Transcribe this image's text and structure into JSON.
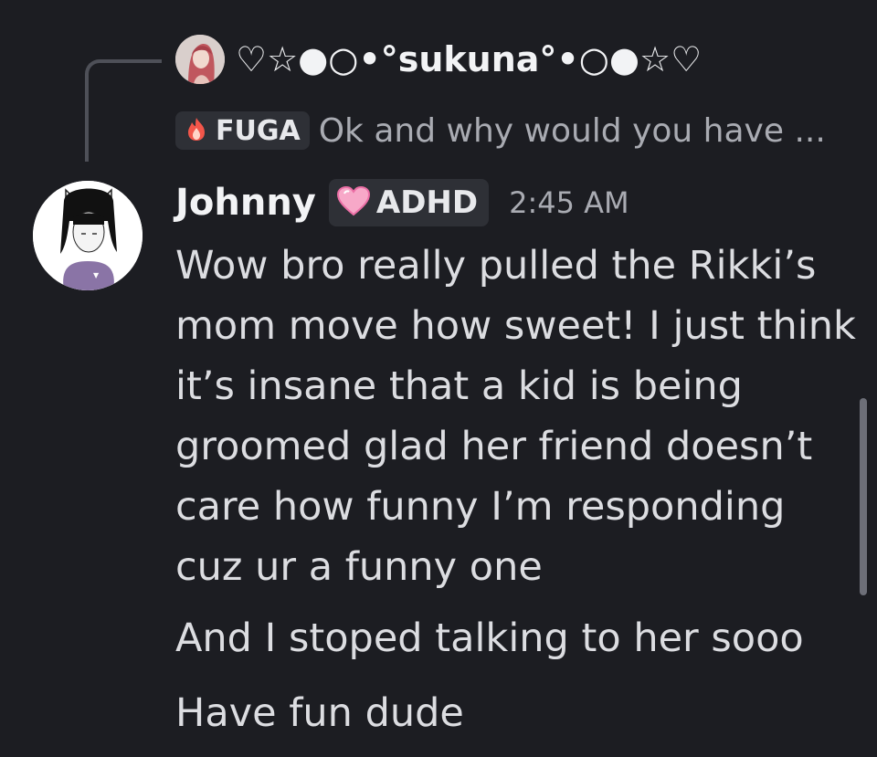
{
  "reply": {
    "author_name": "♡☆●○•°sukuna°•○●☆♡",
    "tag": {
      "icon": "fire-icon",
      "label": "FUGA"
    },
    "snippet": "Ok and why would you have ..."
  },
  "message": {
    "author": "Johnny",
    "role_badge": {
      "icon": "pink-heart-icon",
      "label": "ADHD"
    },
    "timestamp": "2:45 AM",
    "lines": [
      "Wow bro really pulled the Rikki’s mom move how sweet! I just think it’s insane that a kid is being groomed glad her friend doesn’t care how funny I’m responding cuz ur a funny one",
      "And I stoped talking to her sooo",
      "Have fun dude"
    ]
  },
  "colors": {
    "background": "#1c1d22",
    "text": "#dcdde1",
    "muted": "#a9abb2",
    "badge_bg": "#2e3036",
    "heart": "#f7a8c8",
    "fire": "#f2564a"
  }
}
